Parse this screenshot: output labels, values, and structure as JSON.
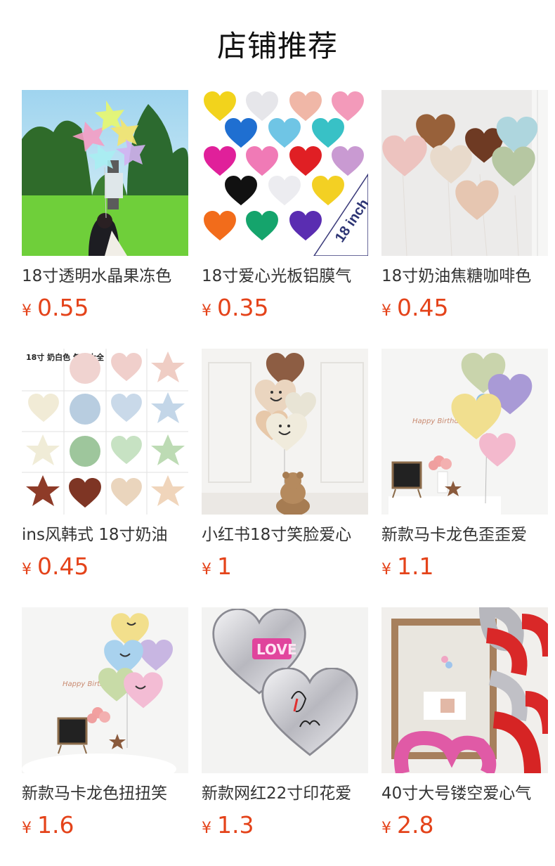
{
  "section": {
    "title": "店铺推荐"
  },
  "colors": {
    "price": "#e4431a",
    "title": "#111111",
    "text": "#333333"
  },
  "products": [
    {
      "name": "18寸透明水晶果冻色",
      "currency": "¥",
      "price": "0.55",
      "image": "pastel-star-balloons-outdoor-photo",
      "image_text": ""
    },
    {
      "name": "18寸爱心光板铝膜气",
      "currency": "¥",
      "price": "0.35",
      "image": "colorful-heart-foil-balloon-grid",
      "image_text": "18 inch"
    },
    {
      "name": "18寸奶油焦糖咖啡色",
      "currency": "¥",
      "price": "0.45",
      "image": "cream-caramel-heart-balloons",
      "image_text": ""
    },
    {
      "name": "ins风韩式 18寸奶油",
      "currency": "¥",
      "price": "0.45",
      "image": "cream-balloon-shape-chart",
      "image_text": "18寸 奶白色 气球大全"
    },
    {
      "name": "小红书18寸笑脸爱心",
      "currency": "¥",
      "price": "1",
      "image": "smiley-heart-balloons-teddy-bear",
      "image_text": ""
    },
    {
      "name": "新款马卡龙色歪歪爱",
      "currency": "¥",
      "price": "1.1",
      "image": "macaron-tilted-heart-balloons-birthday",
      "image_text": "Happy Birthday"
    },
    {
      "name": "新款马卡龙色扭扭笑",
      "currency": "¥",
      "price": "1.6",
      "image": "macaron-twisted-smiley-balloons-birthday",
      "image_text": "Happy Birthday"
    },
    {
      "name": "新款网红22寸印花爱",
      "currency": "¥",
      "price": "1.3",
      "image": "silver-printed-heart-balloons",
      "image_text": "LOVE"
    },
    {
      "name": "40寸大号镂空爱心气",
      "currency": "¥",
      "price": "2.8",
      "image": "large-hollow-heart-balloons-mirror",
      "image_text": ""
    }
  ]
}
